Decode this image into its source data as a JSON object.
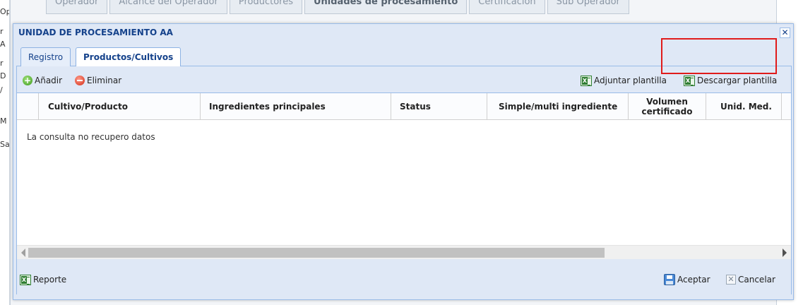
{
  "background": {
    "left_fragments": [
      "Operac",
      "r",
      "A",
      "r",
      "D",
      "/",
      "M",
      "Sa"
    ],
    "tabs": [
      "Operador",
      "Alcance del Operador",
      "Productores",
      "Unidades de procesamiento",
      "Certificación",
      "Sub Operador"
    ]
  },
  "dialog": {
    "title": "UNIDAD DE PROCESAMIENTO AA",
    "close_glyph": "✕",
    "tabs": [
      "Registro",
      "Productos/Cultivos"
    ],
    "toolbar": {
      "add_label": "Añadir",
      "delete_label": "Eliminar",
      "attach_template_label": "Adjuntar plantilla",
      "download_template_label": "Descargar plantilla"
    },
    "grid": {
      "columns": [
        "Cultivo/Producto",
        "Ingredientes principales",
        "Status",
        "Simple/multi ingrediente",
        "Volumen certificado",
        "Unid. Med."
      ],
      "empty_message": "La consulta no recupero datos"
    },
    "footer": {
      "report_label": "Reporte",
      "accept_label": "Aceptar",
      "cancel_label": "Cancelar"
    }
  },
  "colors": {
    "highlight": "#e01b1b",
    "title": "#15428b",
    "frame": "#dfe8f6"
  }
}
